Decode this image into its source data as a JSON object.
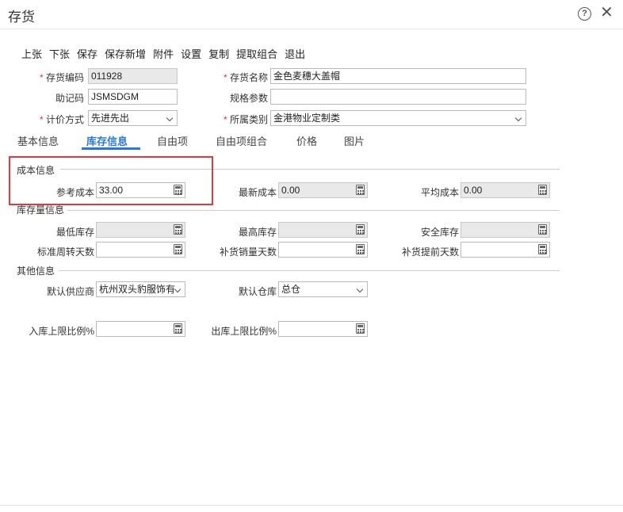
{
  "window": {
    "title": "存货"
  },
  "toolbar": [
    "上张",
    "下张",
    "保存",
    "保存新增",
    "附件",
    "设置",
    "复制",
    "提取组合",
    "退出"
  ],
  "header": {
    "code_label": "存货编码",
    "code_value": "011928",
    "name_label": "存货名称",
    "name_value": "金色麦穗大盖帽",
    "mnemonic_label": "助记码",
    "mnemonic_value": "JSMSDGM",
    "spec_label": "规格参数",
    "spec_value": "",
    "pricing_label": "计价方式",
    "pricing_value": "先进先出",
    "category_label": "所属类别",
    "category_value": "金港物业定制类"
  },
  "tabs": [
    "基本信息",
    "库存信息",
    "自由项",
    "自由项组合",
    "价格",
    "图片"
  ],
  "active_tab": "库存信息",
  "cost": {
    "section": "成本信息",
    "ref_label": "参考成本",
    "ref_value": "33.00",
    "latest_label": "最新成本",
    "latest_value": "0.00",
    "avg_label": "平均成本",
    "avg_value": "0.00"
  },
  "stock": {
    "section": "库存量信息",
    "min_label": "最低库存",
    "max_label": "最高库存",
    "safe_label": "安全库存",
    "turnover_label": "标准周转天数",
    "replenish_sales_label": "补货销量天数",
    "lead_label": "补货提前天数"
  },
  "other": {
    "section": "其他信息",
    "supplier_label": "默认供应商",
    "supplier_value": "杭州双头豹服饰有",
    "warehouse_label": "默认仓库",
    "warehouse_value": "总仓",
    "in_ratio_label": "入库上限比例%",
    "out_ratio_label": "出库上限比例%"
  }
}
